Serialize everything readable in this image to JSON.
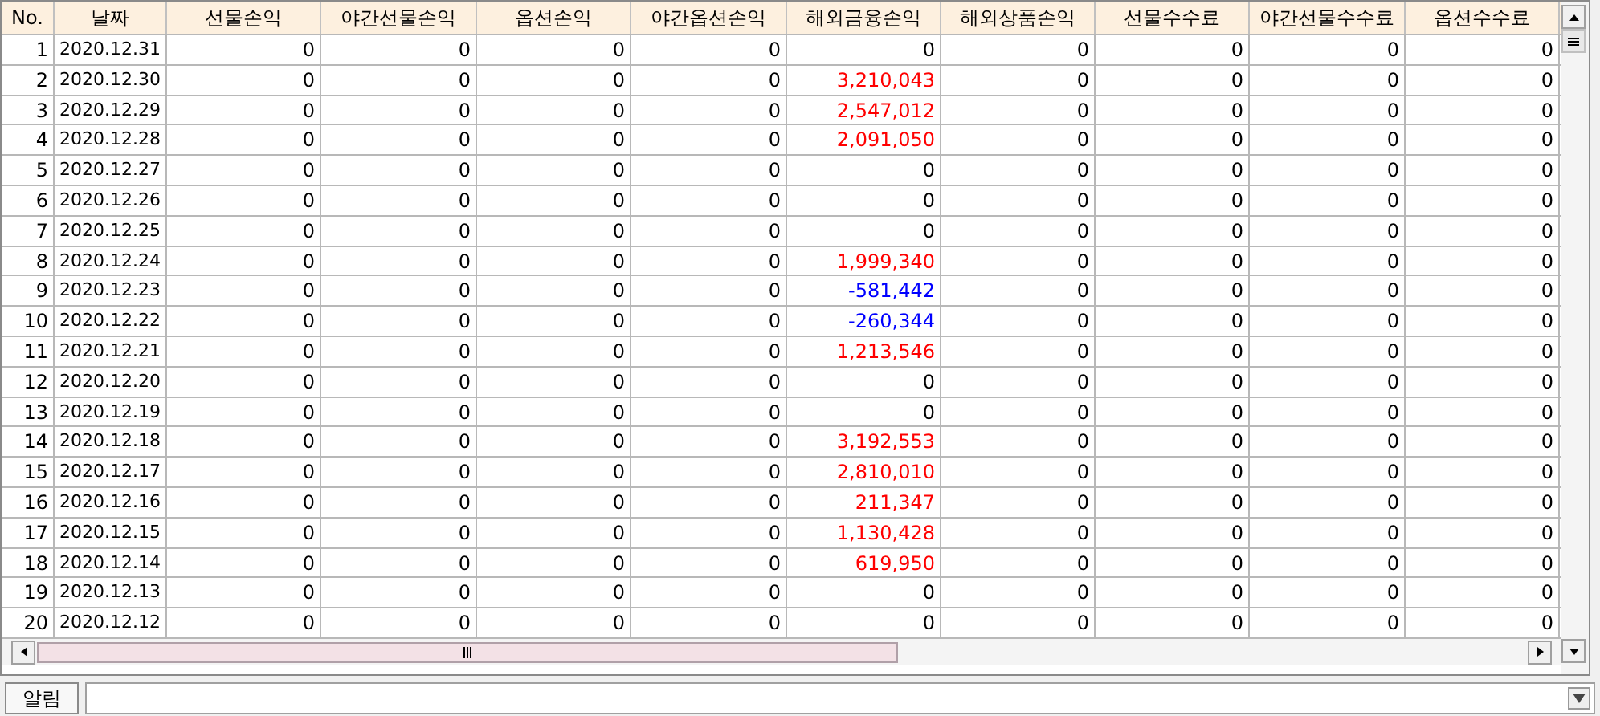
{
  "table": {
    "columns": [
      "No.",
      "날짜",
      "선물손익",
      "야간선물손익",
      "옵션손익",
      "야간옵션손익",
      "해외금융손익",
      "해외상품손익",
      "선물수수료",
      "야간선물수수료",
      "옵션수수료"
    ],
    "rows": [
      {
        "no": "1",
        "date": "2020.12.31",
        "values": [
          "0",
          "0",
          "0",
          "0",
          "0",
          "0",
          "0",
          "0",
          "0"
        ],
        "color": "#000000"
      },
      {
        "no": "2",
        "date": "2020.12.30",
        "values": [
          "0",
          "0",
          "0",
          "0",
          "3,210,043",
          "0",
          "0",
          "0",
          "0"
        ],
        "color": "#ff0000"
      },
      {
        "no": "3",
        "date": "2020.12.29",
        "values": [
          "0",
          "0",
          "0",
          "0",
          "2,547,012",
          "0",
          "0",
          "0",
          "0"
        ],
        "color": "#ff0000"
      },
      {
        "no": "4",
        "date": "2020.12.28",
        "values": [
          "0",
          "0",
          "0",
          "0",
          "2,091,050",
          "0",
          "0",
          "0",
          "0"
        ],
        "color": "#ff0000"
      },
      {
        "no": "5",
        "date": "2020.12.27",
        "values": [
          "0",
          "0",
          "0",
          "0",
          "0",
          "0",
          "0",
          "0",
          "0"
        ],
        "color": "#000000"
      },
      {
        "no": "6",
        "date": "2020.12.26",
        "values": [
          "0",
          "0",
          "0",
          "0",
          "0",
          "0",
          "0",
          "0",
          "0"
        ],
        "color": "#000000"
      },
      {
        "no": "7",
        "date": "2020.12.25",
        "values": [
          "0",
          "0",
          "0",
          "0",
          "0",
          "0",
          "0",
          "0",
          "0"
        ],
        "color": "#000000"
      },
      {
        "no": "8",
        "date": "2020.12.24",
        "values": [
          "0",
          "0",
          "0",
          "0",
          "1,999,340",
          "0",
          "0",
          "0",
          "0"
        ],
        "color": "#ff0000"
      },
      {
        "no": "9",
        "date": "2020.12.23",
        "values": [
          "0",
          "0",
          "0",
          "0",
          "-581,442",
          "0",
          "0",
          "0",
          "0"
        ],
        "color": "#0000ff"
      },
      {
        "no": "10",
        "date": "2020.12.22",
        "values": [
          "0",
          "0",
          "0",
          "0",
          "-260,344",
          "0",
          "0",
          "0",
          "0"
        ],
        "color": "#0000ff"
      },
      {
        "no": "11",
        "date": "2020.12.21",
        "values": [
          "0",
          "0",
          "0",
          "0",
          "1,213,546",
          "0",
          "0",
          "0",
          "0"
        ],
        "color": "#ff0000"
      },
      {
        "no": "12",
        "date": "2020.12.20",
        "values": [
          "0",
          "0",
          "0",
          "0",
          "0",
          "0",
          "0",
          "0",
          "0"
        ],
        "color": "#000000"
      },
      {
        "no": "13",
        "date": "2020.12.19",
        "values": [
          "0",
          "0",
          "0",
          "0",
          "0",
          "0",
          "0",
          "0",
          "0"
        ],
        "color": "#000000"
      },
      {
        "no": "14",
        "date": "2020.12.18",
        "values": [
          "0",
          "0",
          "0",
          "0",
          "3,192,553",
          "0",
          "0",
          "0",
          "0"
        ],
        "color": "#ff0000"
      },
      {
        "no": "15",
        "date": "2020.12.17",
        "values": [
          "0",
          "0",
          "0",
          "0",
          "2,810,010",
          "0",
          "0",
          "0",
          "0"
        ],
        "color": "#ff0000"
      },
      {
        "no": "16",
        "date": "2020.12.16",
        "values": [
          "0",
          "0",
          "0",
          "0",
          "211,347",
          "0",
          "0",
          "0",
          "0"
        ],
        "color": "#ff0000"
      },
      {
        "no": "17",
        "date": "2020.12.15",
        "values": [
          "0",
          "0",
          "0",
          "0",
          "1,130,428",
          "0",
          "0",
          "0",
          "0"
        ],
        "color": "#ff0000"
      },
      {
        "no": "18",
        "date": "2020.12.14",
        "values": [
          "0",
          "0",
          "0",
          "0",
          "619,950",
          "0",
          "0",
          "0",
          "0"
        ],
        "color": "#ff0000"
      },
      {
        "no": "19",
        "date": "2020.12.13",
        "values": [
          "0",
          "0",
          "0",
          "0",
          "0",
          "0",
          "0",
          "0",
          "0"
        ],
        "color": "#000000"
      },
      {
        "no": "20",
        "date": "2020.12.12",
        "values": [
          "0",
          "0",
          "0",
          "0",
          "0",
          "0",
          "0",
          "0",
          "0"
        ],
        "color": "#000000"
      }
    ]
  },
  "status_bar": {
    "label": "알림"
  }
}
